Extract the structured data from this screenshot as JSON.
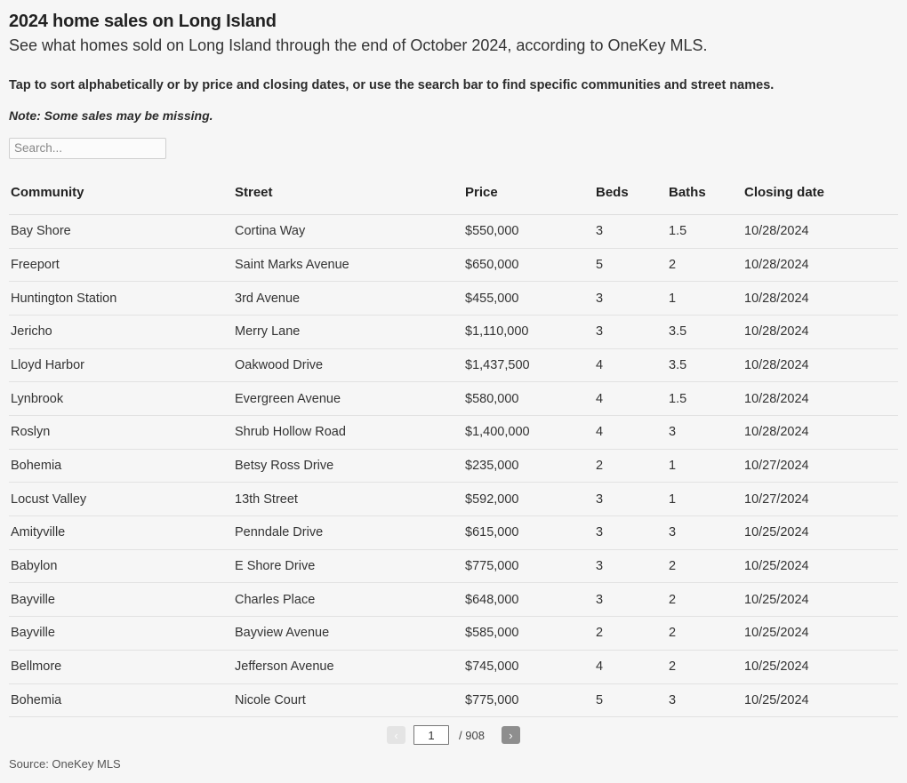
{
  "header": {
    "title": "2024 home sales on Long Island",
    "subtitle": "See what homes sold on Long Island through the end of October 2024, according to OneKey MLS.",
    "instructions": "Tap to sort alphabetically or by price and closing dates, or use the search bar to find specific communities and street names.",
    "note": "Note: Some sales may be missing."
  },
  "search": {
    "placeholder": "Search...",
    "value": ""
  },
  "table": {
    "columns": [
      {
        "key": "community",
        "label": "Community"
      },
      {
        "key": "street",
        "label": "Street"
      },
      {
        "key": "price",
        "label": "Price"
      },
      {
        "key": "beds",
        "label": "Beds"
      },
      {
        "key": "baths",
        "label": "Baths"
      },
      {
        "key": "closing_date",
        "label": "Closing date"
      }
    ],
    "rows": [
      {
        "community": "Bay Shore",
        "street": "Cortina Way",
        "price": "$550,000",
        "beds": "3",
        "baths": "1.5",
        "closing_date": "10/28/2024"
      },
      {
        "community": "Freeport",
        "street": "Saint Marks Avenue",
        "price": "$650,000",
        "beds": "5",
        "baths": "2",
        "closing_date": "10/28/2024"
      },
      {
        "community": "Huntington Station",
        "street": "3rd Avenue",
        "price": "$455,000",
        "beds": "3",
        "baths": "1",
        "closing_date": "10/28/2024"
      },
      {
        "community": "Jericho",
        "street": "Merry Lane",
        "price": "$1,110,000",
        "beds": "3",
        "baths": "3.5",
        "closing_date": "10/28/2024"
      },
      {
        "community": "Lloyd Harbor",
        "street": "Oakwood Drive",
        "price": "$1,437,500",
        "beds": "4",
        "baths": "3.5",
        "closing_date": "10/28/2024"
      },
      {
        "community": "Lynbrook",
        "street": "Evergreen Avenue",
        "price": "$580,000",
        "beds": "4",
        "baths": "1.5",
        "closing_date": "10/28/2024"
      },
      {
        "community": "Roslyn",
        "street": "Shrub Hollow Road",
        "price": "$1,400,000",
        "beds": "4",
        "baths": "3",
        "closing_date": "10/28/2024"
      },
      {
        "community": "Bohemia",
        "street": "Betsy Ross Drive",
        "price": "$235,000",
        "beds": "2",
        "baths": "1",
        "closing_date": "10/27/2024"
      },
      {
        "community": "Locust Valley",
        "street": "13th Street",
        "price": "$592,000",
        "beds": "3",
        "baths": "1",
        "closing_date": "10/27/2024"
      },
      {
        "community": "Amityville",
        "street": "Penndale Drive",
        "price": "$615,000",
        "beds": "3",
        "baths": "3",
        "closing_date": "10/25/2024"
      },
      {
        "community": "Babylon",
        "street": "E Shore Drive",
        "price": "$775,000",
        "beds": "3",
        "baths": "2",
        "closing_date": "10/25/2024"
      },
      {
        "community": "Bayville",
        "street": "Charles Place",
        "price": "$648,000",
        "beds": "3",
        "baths": "2",
        "closing_date": "10/25/2024"
      },
      {
        "community": "Bayville",
        "street": "Bayview Avenue",
        "price": "$585,000",
        "beds": "2",
        "baths": "2",
        "closing_date": "10/25/2024"
      },
      {
        "community": "Bellmore",
        "street": "Jefferson Avenue",
        "price": "$745,000",
        "beds": "4",
        "baths": "2",
        "closing_date": "10/25/2024"
      },
      {
        "community": "Bohemia",
        "street": "Nicole Court",
        "price": "$775,000",
        "beds": "5",
        "baths": "3",
        "closing_date": "10/25/2024"
      }
    ]
  },
  "pagination": {
    "prev_label": "‹",
    "next_label": "›",
    "current_page": "1",
    "total_label": "/ 908",
    "total_pages": 908
  },
  "footer": {
    "source": "Source: OneKey MLS"
  },
  "colors": {
    "background": "#f6f6f6",
    "text": "#333333",
    "heading": "#222222",
    "row_divider": "#e2e2e2",
    "header_divider": "#dddddd",
    "next_button": "#8e8e8e",
    "prev_button_disabled": "#e4e4e4"
  }
}
